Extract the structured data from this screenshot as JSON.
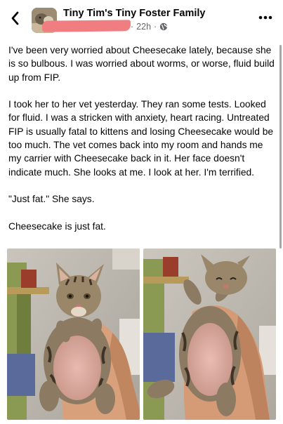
{
  "header": {
    "back_icon": "chevron-left-icon",
    "page_name": "Tiny Tim's Tiny Foster Family",
    "timestamp": "22h",
    "audience_icon": "globe-icon",
    "more_icon": "more-horizontal-icon"
  },
  "post": {
    "paragraphs": [
      "I've been very worried about Cheesecake lately, because she is so bulbous. I was worried about worms, or worse, fluid build up from FIP.",
      "I took her to her vet yesterday. They ran some tests. Looked for fluid. I was a stricken with anxiety, heart racing. Untreated FIP is usually fatal to kittens and losing Cheesecake would be too much. The vet comes back into my room and hands me my carrier with Cheesecake back in it. Her face doesn't indicate much. She looks at me. I look at her. I'm terrified.",
      "\"Just fat.\" She says.",
      "Cheesecake is just fat."
    ]
  },
  "colors": {
    "redaction": "#f07d80",
    "meta_text": "#65676b"
  }
}
